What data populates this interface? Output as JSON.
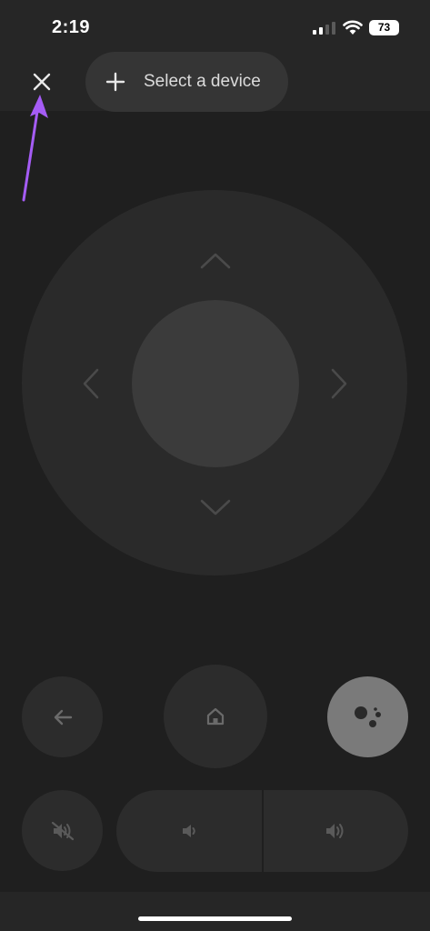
{
  "status_bar": {
    "time": "2:19",
    "battery": "73",
    "signal_icon": "cellular-signal-icon",
    "wifi_icon": "wifi-icon"
  },
  "header": {
    "close_icon": "close-icon",
    "device_selector_label": "Select a device",
    "device_selector_icon": "plus-icon"
  },
  "dpad": {
    "up_icon": "chevron-up-icon",
    "down_icon": "chevron-down-icon",
    "left_icon": "chevron-left-icon",
    "right_icon": "chevron-right-icon"
  },
  "controls": {
    "back_icon": "back-arrow-icon",
    "home_icon": "home-icon",
    "assistant_icon": "google-assistant-icon",
    "mute_icon": "mute-icon",
    "volume_down_icon": "volume-down-icon",
    "volume_up_icon": "volume-up-icon"
  },
  "colors": {
    "background": "#1f1f1f",
    "surface": "#2c2c2c",
    "dpad_center": "#3b3b3b",
    "assistant_button": "#7a7a7a",
    "annotation_arrow": "#a55cf5"
  }
}
